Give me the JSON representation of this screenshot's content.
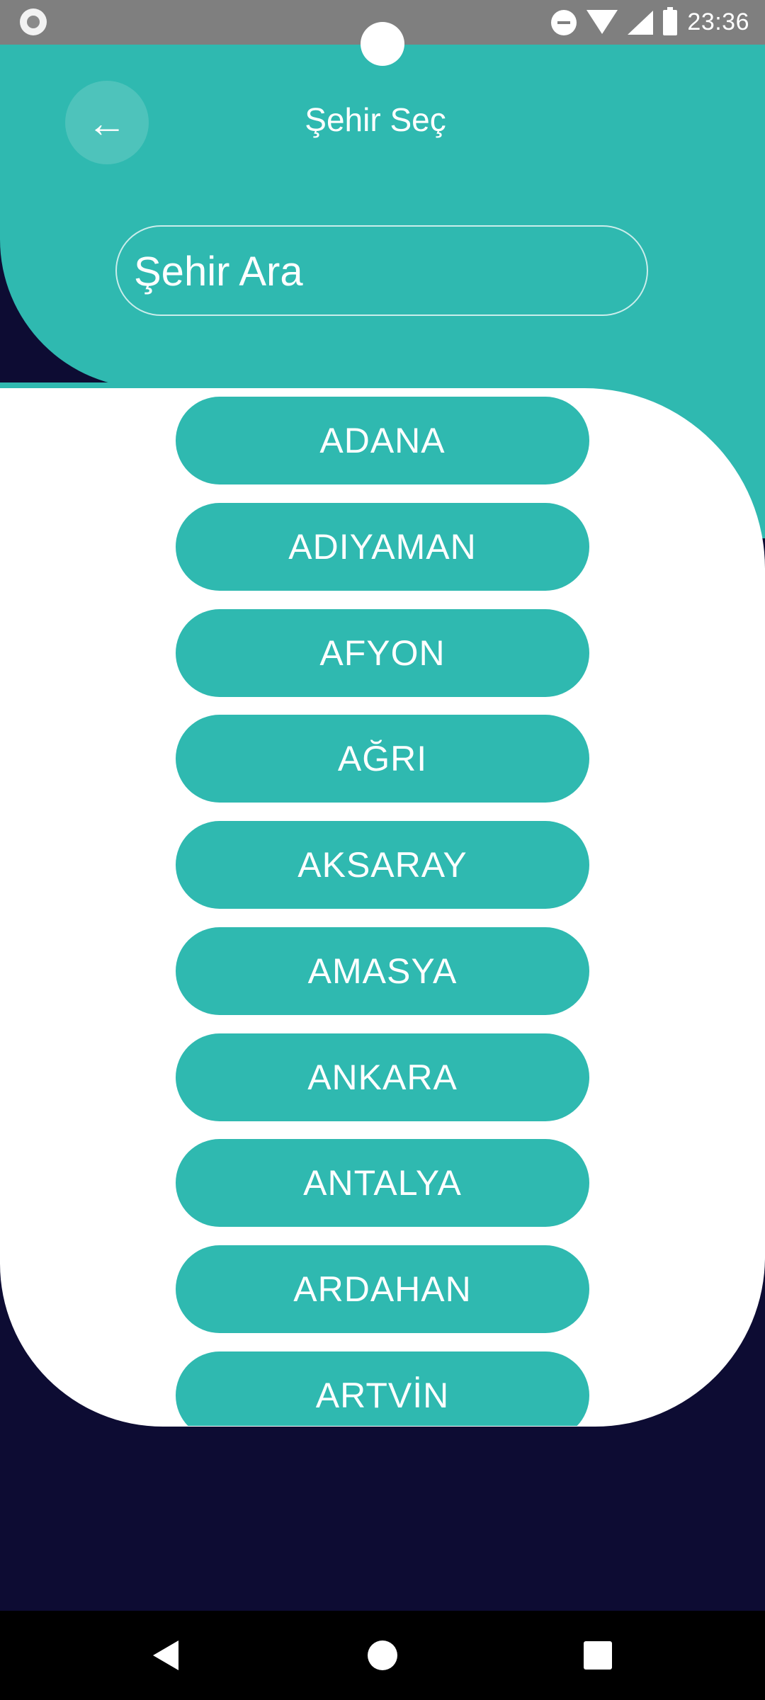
{
  "status_bar": {
    "time": "23:36",
    "icons": [
      "app-notification-icon",
      "do-not-disturb-icon",
      "wifi-icon",
      "signal-icon",
      "battery-icon"
    ]
  },
  "header": {
    "back_icon": "←",
    "title": "Şehir Seç"
  },
  "search": {
    "placeholder": "Şehir Ara"
  },
  "cities": [
    "ADANA",
    "ADIYAMAN",
    "AFYON",
    "AĞRI",
    "AKSARAY",
    "AMASYA",
    "ANKARA",
    "ANTALYA",
    "ARDAHAN",
    "ARTVİN"
  ],
  "colors": {
    "accent": "#2fb9b0",
    "background_dark": "#0d0c33",
    "card": "#ffffff"
  },
  "nav_bar": {
    "buttons": [
      "back-icon",
      "home-icon",
      "recents-icon"
    ]
  }
}
